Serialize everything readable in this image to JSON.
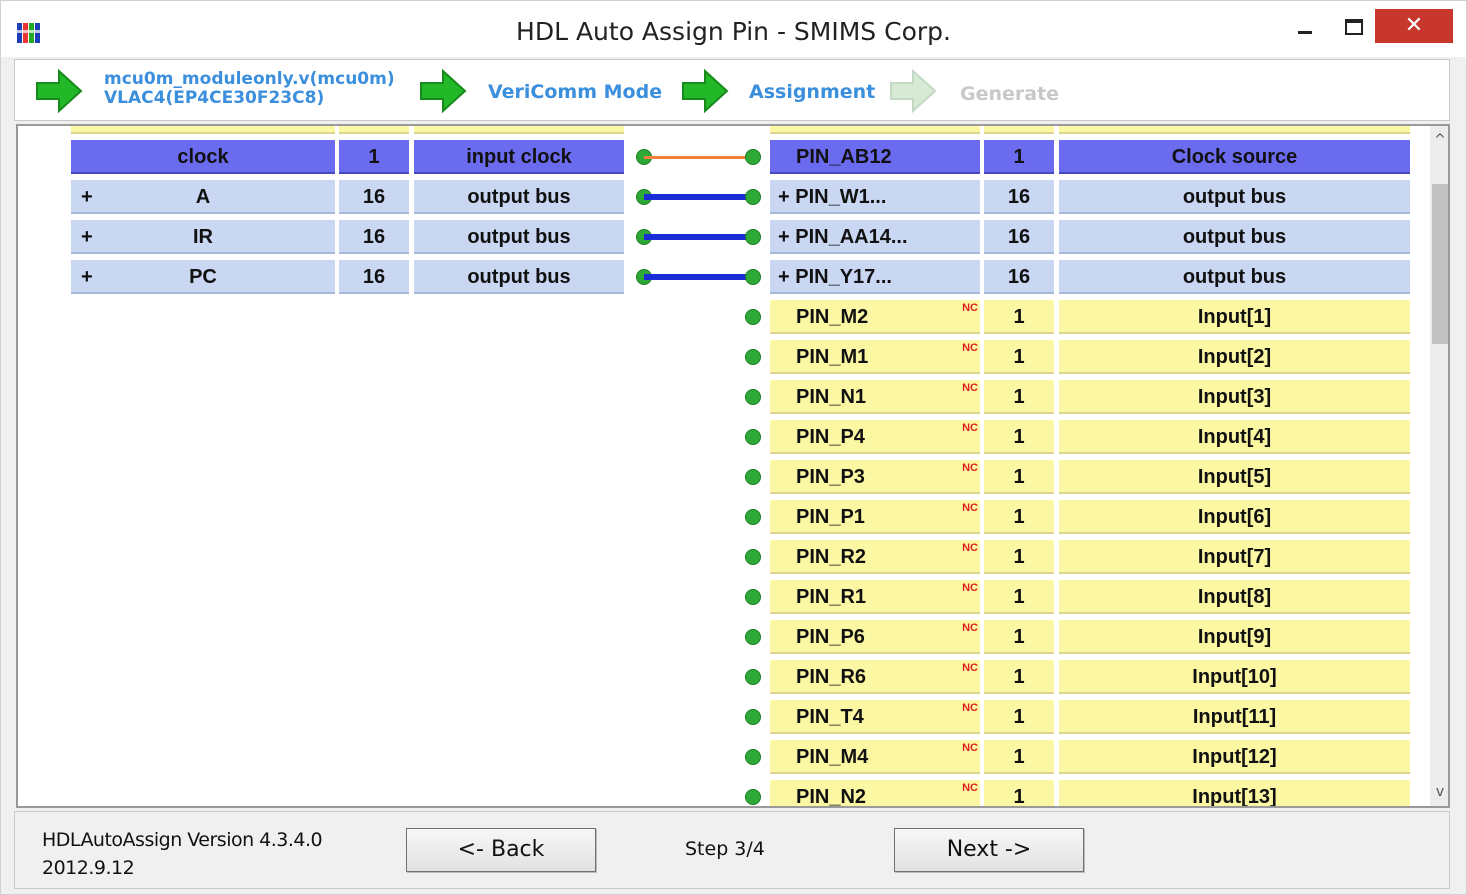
{
  "window": {
    "title": "HDL Auto Assign Pin - SMIMS Corp.",
    "close_glyph": "✕"
  },
  "steps": [
    {
      "line1": "mcu0m_moduleonly.v(mcu0m)",
      "line2": "VLAC4(EP4CE30F23C8)",
      "icon": "green-arrow-icon",
      "active": true
    },
    {
      "label": "VeriComm Mode",
      "icon": "green-arrow-icon",
      "active": true
    },
    {
      "label": "Assignment",
      "icon": "green-arrow-icon",
      "active": true
    },
    {
      "label": "Generate",
      "icon": "gray-arrow-icon",
      "active": false
    }
  ],
  "signals": [
    {
      "name": "clock",
      "width": "1",
      "type": "input clock",
      "expandable": false,
      "wire_color": "#ef7f3a",
      "selected": true
    },
    {
      "name": "A",
      "width": "16",
      "type": "output bus",
      "expandable": true,
      "wire_color": "#1a2bd8",
      "selected": false
    },
    {
      "name": "IR",
      "width": "16",
      "type": "output bus",
      "expandable": true,
      "wire_color": "#1a2bd8",
      "selected": false
    },
    {
      "name": "PC",
      "width": "16",
      "type": "output bus",
      "expandable": true,
      "wire_color": "#1a2bd8",
      "selected": false
    }
  ],
  "expand_glyph": "+",
  "pins": [
    {
      "pin": "PIN_AB12",
      "width": "1",
      "desc": "Clock source",
      "state": "selected"
    },
    {
      "pin": "+ PIN_W1...",
      "width": "16",
      "desc": "output bus",
      "state": "assigned"
    },
    {
      "pin": "+ PIN_AA14...",
      "width": "16",
      "desc": "output bus",
      "state": "assigned"
    },
    {
      "pin": "+ PIN_Y17...",
      "width": "16",
      "desc": "output bus",
      "state": "assigned"
    },
    {
      "pin": "PIN_M2",
      "width": "1",
      "desc": "Input[1]",
      "state": "free",
      "nc": "NC"
    },
    {
      "pin": "PIN_M1",
      "width": "1",
      "desc": "Input[2]",
      "state": "free",
      "nc": "NC"
    },
    {
      "pin": "PIN_N1",
      "width": "1",
      "desc": "Input[3]",
      "state": "free",
      "nc": "NC"
    },
    {
      "pin": "PIN_P4",
      "width": "1",
      "desc": "Input[4]",
      "state": "free",
      "nc": "NC"
    },
    {
      "pin": "PIN_P3",
      "width": "1",
      "desc": "Input[5]",
      "state": "free",
      "nc": "NC"
    },
    {
      "pin": "PIN_P1",
      "width": "1",
      "desc": "Input[6]",
      "state": "free",
      "nc": "NC"
    },
    {
      "pin": "PIN_R2",
      "width": "1",
      "desc": "Input[7]",
      "state": "free",
      "nc": "NC"
    },
    {
      "pin": "PIN_R1",
      "width": "1",
      "desc": "Input[8]",
      "state": "free",
      "nc": "NC"
    },
    {
      "pin": "PIN_P6",
      "width": "1",
      "desc": "Input[9]",
      "state": "free",
      "nc": "NC"
    },
    {
      "pin": "PIN_R6",
      "width": "1",
      "desc": "Input[10]",
      "state": "free",
      "nc": "NC"
    },
    {
      "pin": "PIN_T4",
      "width": "1",
      "desc": "Input[11]",
      "state": "free",
      "nc": "NC"
    },
    {
      "pin": "PIN_M4",
      "width": "1",
      "desc": "Input[12]",
      "state": "free",
      "nc": "NC"
    },
    {
      "pin": "PIN_N2",
      "width": "1",
      "desc": "Input[13]",
      "state": "free",
      "nc": "NC"
    }
  ],
  "scrollbar": {
    "up": "^",
    "down": "v"
  },
  "footer": {
    "version_line1": "HDLAutoAssign Version 4.3.4.0",
    "version_line2": "2012.9.12",
    "back_label": "<- Back",
    "step_label": "Step 3/4",
    "next_label": "Next ->"
  },
  "colors": {
    "selected_row": "#6b6bf0",
    "assigned_row": "#c9d7f2",
    "free_row": "#fbf7a3",
    "step_active": "#3b8fdd",
    "connector_dot": "#2ea836"
  }
}
